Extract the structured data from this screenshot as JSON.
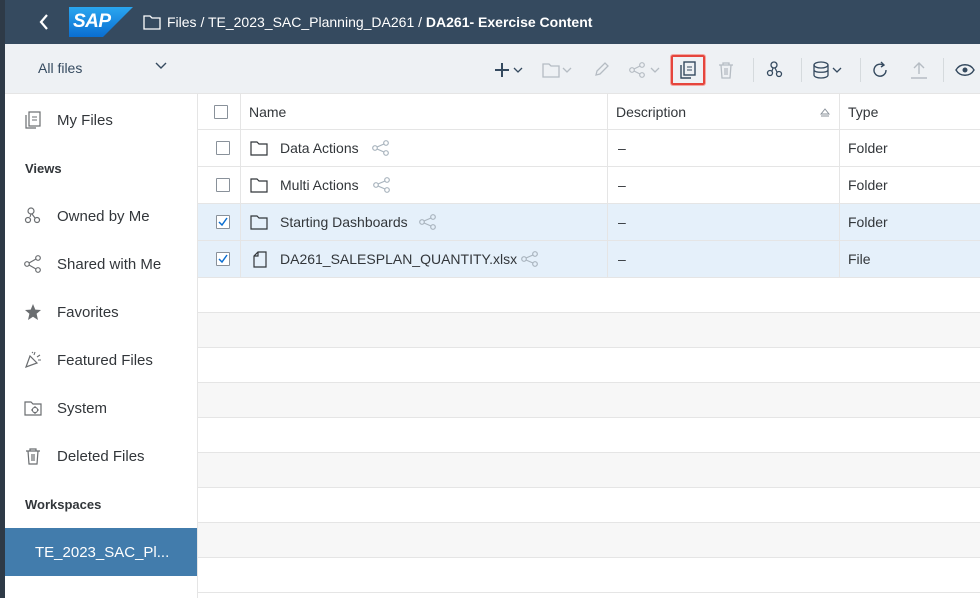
{
  "shell": {
    "logo_text": "SAP",
    "breadcrumb_path": "Files / TE_2023_SAC_Planning_DA261 / ",
    "breadcrumb_current": "DA261- Exercise Content"
  },
  "toolbar": {
    "filter_label": "All files",
    "highlighted_action": "copy-button"
  },
  "sidebar": {
    "my_files": "My Files",
    "views_heading": "Views",
    "owned_by_me": "Owned by Me",
    "shared_with_me": "Shared with Me",
    "favorites": "Favorites",
    "featured_files": "Featured Files",
    "system": "System",
    "deleted_files": "Deleted Files",
    "workspaces_heading": "Workspaces",
    "workspace_item": "TE_2023_SAC_Pl..."
  },
  "table": {
    "columns": {
      "name": "Name",
      "description": "Description",
      "type": "Type"
    },
    "rows": [
      {
        "name": "Data Actions",
        "description": "–",
        "type": "Folder",
        "selected": false
      },
      {
        "name": "Multi Actions",
        "description": "–",
        "type": "Folder",
        "selected": false
      },
      {
        "name": "Starting Dashboards",
        "description": "–",
        "type": "Folder",
        "selected": true
      },
      {
        "name": "DA261_SALESPLAN_QUANTITY.xlsx",
        "description": "–",
        "type": "File",
        "selected": true
      }
    ]
  },
  "colors": {
    "shell": "#354a5f",
    "toolbar_bg": "#eef1f4",
    "selected_row": "#e5f0fa",
    "workspace_active": "#427cac",
    "highlight": "#e5453c"
  }
}
